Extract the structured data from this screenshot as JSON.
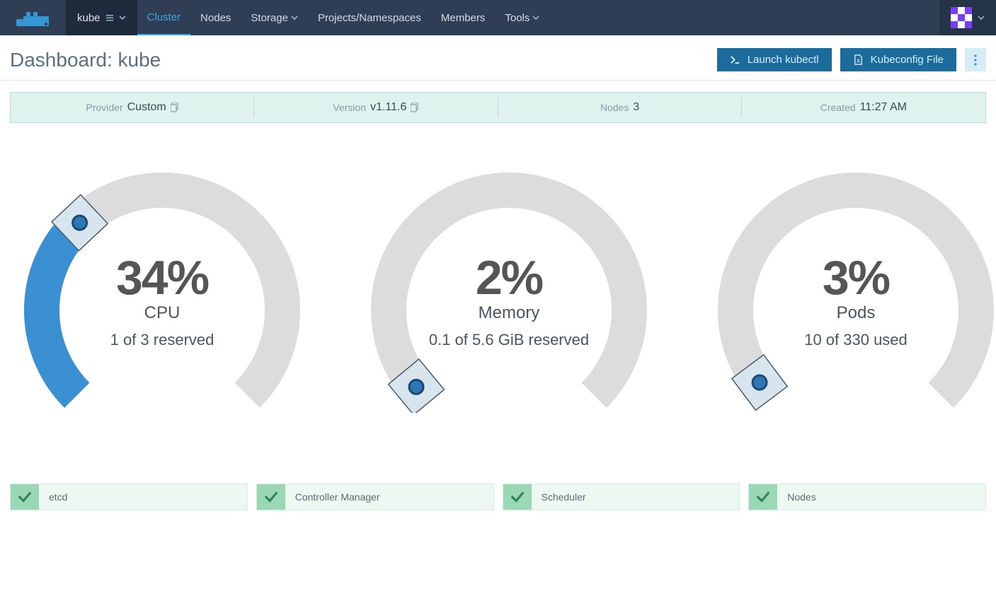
{
  "nav": {
    "cluster_name": "kube",
    "items": [
      "Cluster",
      "Nodes",
      "Storage",
      "Projects/Namespaces",
      "Members",
      "Tools"
    ],
    "active_index": 0,
    "dropdown_indices": [
      2,
      5
    ]
  },
  "page": {
    "title": "Dashboard: kube",
    "launch_kubectl": "Launch kubectl",
    "kubeconfig_file": "Kubeconfig File"
  },
  "info": {
    "provider_label": "Provider",
    "provider_value": "Custom",
    "version_label": "Version",
    "version_value": "v1.11.6",
    "nodes_label": "Nodes",
    "nodes_value": "3",
    "created_label": "Created",
    "created_value": "11:27 AM"
  },
  "chart_data": [
    {
      "type": "gauge",
      "title": "CPU",
      "percent": 34,
      "subtitle": "1 of 3 reserved"
    },
    {
      "type": "gauge",
      "title": "Memory",
      "percent": 2,
      "subtitle": "0.1 of 5.6 GiB reserved"
    },
    {
      "type": "gauge",
      "title": "Pods",
      "percent": 3,
      "subtitle": "10 of 330 used"
    }
  ],
  "status": [
    {
      "label": "etcd"
    },
    {
      "label": "Controller Manager"
    },
    {
      "label": "Scheduler"
    },
    {
      "label": "Nodes"
    }
  ],
  "colors": {
    "accent": "#3a90d1",
    "track": "#dcdcdc",
    "nav_bg": "#2f3e55"
  }
}
